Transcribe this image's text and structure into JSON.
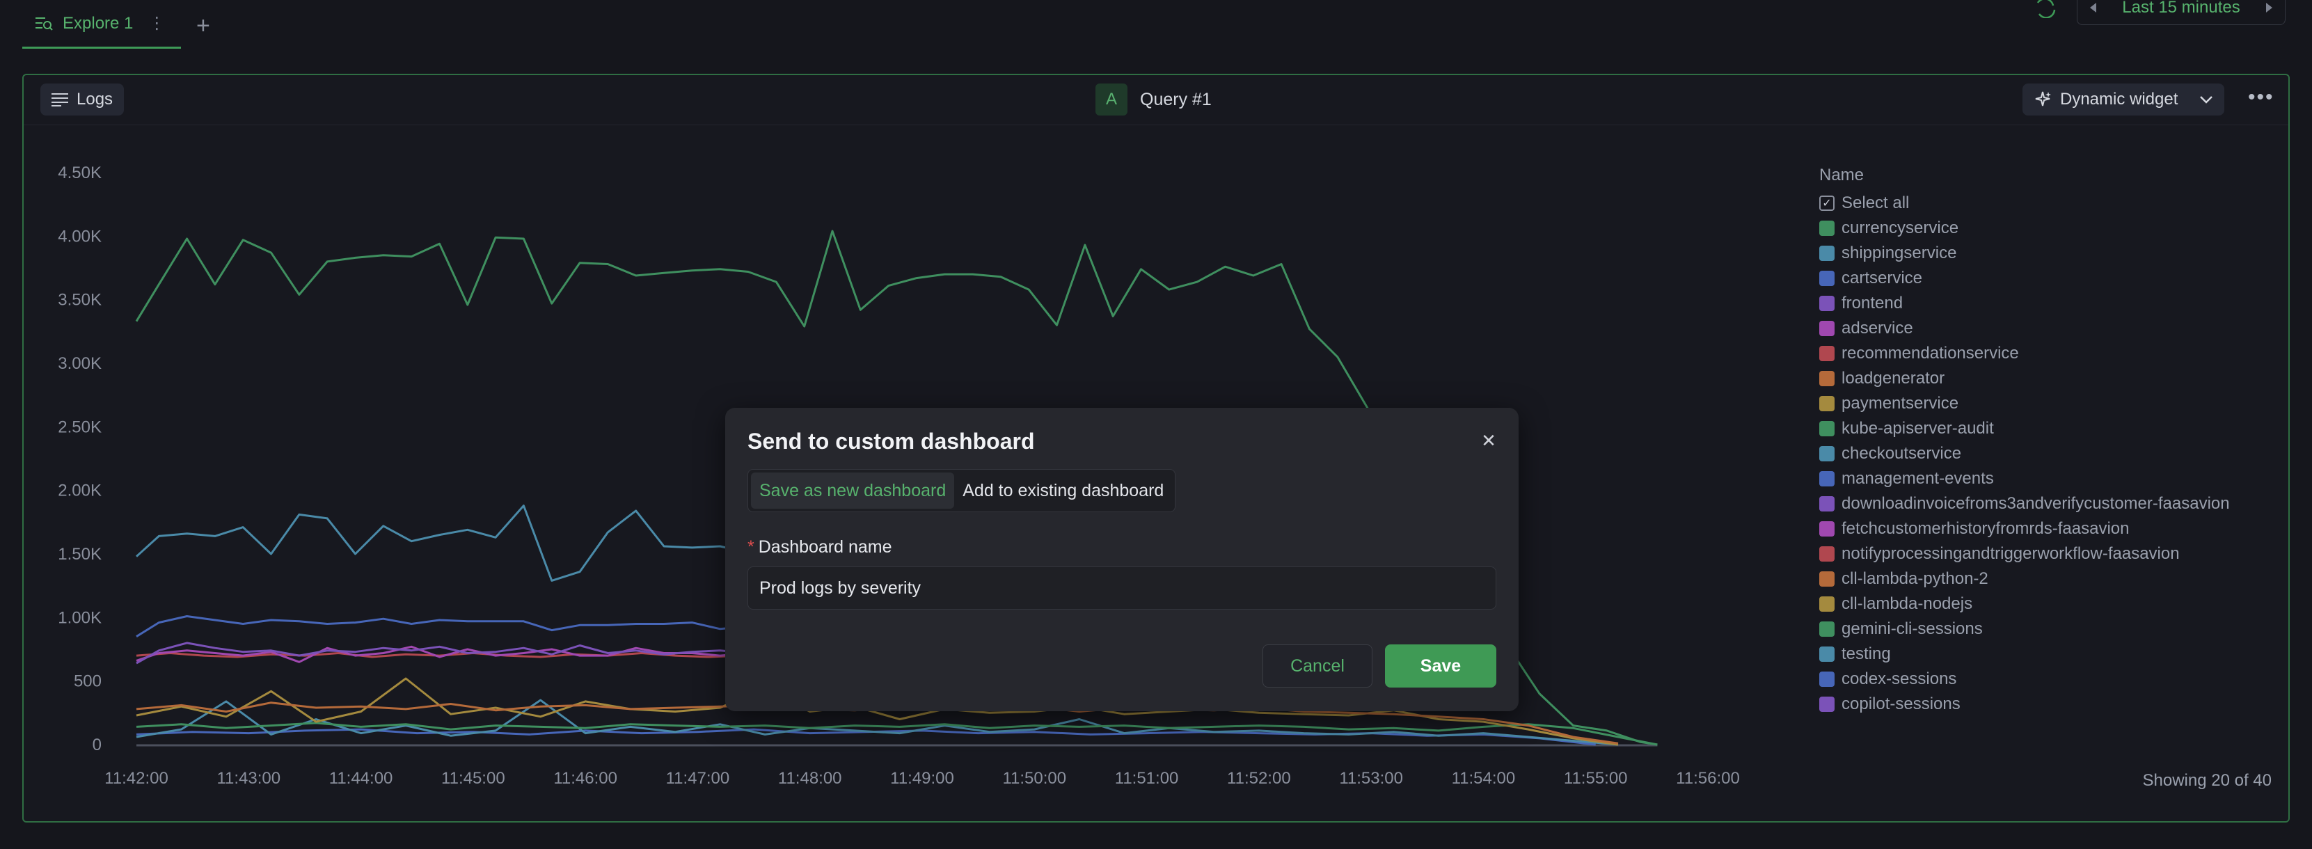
{
  "tabs": [
    {
      "label": "Explore 1"
    }
  ],
  "time_range": {
    "label": "Last 15 minutes"
  },
  "widget": {
    "source_label": "Logs",
    "query_badge": "A",
    "query_label": "Query #1",
    "visualization_label": "Dynamic widget"
  },
  "legend": {
    "title": "Name",
    "select_all": "Select all",
    "items": [
      {
        "label": "currencyservice",
        "color": "#3f8f5f"
      },
      {
        "label": "shippingservice",
        "color": "#4a8aa8"
      },
      {
        "label": "cartservice",
        "color": "#4766b8"
      },
      {
        "label": "frontend",
        "color": "#7b52b8"
      },
      {
        "label": "adservice",
        "color": "#a048b0"
      },
      {
        "label": "recommendationservice",
        "color": "#b0474f"
      },
      {
        "label": "loadgenerator",
        "color": "#b56a3a"
      },
      {
        "label": "paymentservice",
        "color": "#a48a3e"
      },
      {
        "label": "kube-apiserver-audit",
        "color": "#3f8f5f"
      },
      {
        "label": "checkoutservice",
        "color": "#4a8aa8"
      },
      {
        "label": "management-events",
        "color": "#4766b8"
      },
      {
        "label": "downloadinvoicefroms3andverifycustomer-faasavion",
        "color": "#7b52b8"
      },
      {
        "label": "fetchcustomerhistoryfromrds-faasavion",
        "color": "#a048b0"
      },
      {
        "label": "notifyprocessingandtriggerworkflow-faasavion",
        "color": "#b0474f"
      },
      {
        "label": "cll-lambda-python-2",
        "color": "#b56a3a"
      },
      {
        "label": "cll-lambda-nodejs",
        "color": "#a48a3e"
      },
      {
        "label": "gemini-cli-sessions",
        "color": "#3f8f5f"
      },
      {
        "label": "testing",
        "color": "#4a8aa8"
      },
      {
        "label": "codex-sessions",
        "color": "#4766b8"
      },
      {
        "label": "copilot-sessions",
        "color": "#7b52b8"
      }
    ],
    "showing_text": "Showing 20 of 40"
  },
  "chart_data": {
    "type": "line",
    "ylim": [
      0,
      4500
    ],
    "y_ticks": [
      "0",
      "500",
      "1.00K",
      "1.50K",
      "2.00K",
      "2.50K",
      "3.00K",
      "3.50K",
      "4.00K",
      "4.50K"
    ],
    "y_tick_values": [
      0,
      500,
      1000,
      1500,
      2000,
      2500,
      3000,
      3500,
      4000,
      4500
    ],
    "x_ticks": [
      "11:42:00",
      "11:43:00",
      "11:44:00",
      "11:45:00",
      "11:46:00",
      "11:47:00",
      "11:48:00",
      "11:49:00",
      "11:50:00",
      "11:51:00",
      "11:52:00",
      "11:53:00",
      "11:54:00",
      "11:55:00",
      "11:56:00"
    ],
    "x_minutes_range": [
      0,
      14
    ],
    "series": [
      {
        "name": "currencyservice",
        "color": "#3f8f5f",
        "x": [
          0,
          0.2,
          0.45,
          0.7,
          0.95,
          1.2,
          1.45,
          1.7,
          1.95,
          2.2,
          2.45,
          2.7,
          2.95,
          3.2,
          3.45,
          3.7,
          3.95,
          4.2,
          4.45,
          4.7,
          4.95,
          5.2,
          5.45,
          5.7,
          5.95,
          6.2,
          6.45,
          6.7,
          6.95,
          7.2,
          7.45,
          7.7,
          7.95,
          8.2,
          8.45,
          8.7,
          8.95,
          9.2,
          9.45,
          9.7,
          9.95,
          10.2,
          10.45,
          10.7,
          11.0,
          11.3,
          11.6,
          11.9,
          12.2,
          12.5,
          12.8,
          13.1,
          13.4,
          13.55
        ],
        "values": [
          3330,
          3620,
          3980,
          3620,
          3970,
          3870,
          3540,
          3800,
          3830,
          3850,
          3840,
          3940,
          3460,
          3990,
          3980,
          3470,
          3790,
          3780,
          3690,
          3710,
          3730,
          3740,
          3720,
          3640,
          3290,
          4040,
          3420,
          3610,
          3670,
          3700,
          3700,
          3680,
          3580,
          3300,
          3930,
          3370,
          3740,
          3580,
          3640,
          3760,
          3690,
          3780,
          3270,
          3050,
          2600,
          2200,
          1700,
          1200,
          800,
          400,
          150,
          110,
          20,
          0
        ]
      },
      {
        "name": "shippingservice",
        "color": "#4a8aa8",
        "x": [
          0,
          0.2,
          0.45,
          0.7,
          0.95,
          1.2,
          1.45,
          1.7,
          1.95,
          2.2,
          2.45,
          2.7,
          2.95,
          3.2,
          3.45,
          3.7,
          3.95,
          4.2,
          4.45,
          4.7,
          4.95,
          5.2,
          5.45,
          5.7,
          5.95
        ],
        "values": [
          1480,
          1640,
          1660,
          1640,
          1710,
          1500,
          1810,
          1780,
          1500,
          1720,
          1600,
          1650,
          1690,
          1630,
          1880,
          1290,
          1360,
          1670,
          1840,
          1560,
          1550,
          1560,
          1510,
          1470,
          1380
        ]
      },
      {
        "name": "cartservice",
        "color": "#4766b8",
        "x": [
          0,
          0.2,
          0.45,
          0.7,
          0.95,
          1.2,
          1.45,
          1.7,
          1.95,
          2.2,
          2.45,
          2.7,
          2.95,
          3.2,
          3.45,
          3.7,
          3.95,
          4.2,
          4.45,
          4.7,
          4.95,
          5.2,
          5.45,
          5.7,
          5.95
        ],
        "values": [
          850,
          960,
          1010,
          980,
          950,
          980,
          970,
          950,
          960,
          990,
          950,
          980,
          970,
          970,
          970,
          900,
          940,
          940,
          950,
          950,
          960,
          910,
          930,
          900,
          880
        ]
      },
      {
        "name": "frontend",
        "color": "#7b52b8",
        "x": [
          0,
          0.2,
          0.45,
          0.7,
          0.95,
          1.2,
          1.45,
          1.7,
          1.95,
          2.2,
          2.45,
          2.7,
          2.95,
          3.2,
          3.45,
          3.7,
          3.95,
          4.2,
          4.45,
          4.7,
          4.95,
          5.2,
          5.45,
          5.7,
          5.95
        ],
        "values": [
          640,
          740,
          800,
          760,
          730,
          740,
          700,
          740,
          730,
          760,
          740,
          770,
          720,
          730,
          760,
          710,
          780,
          720,
          740,
          710,
          730,
          740,
          720,
          730,
          740
        ]
      },
      {
        "name": "adservice",
        "color": "#a048b0",
        "x": [
          0,
          0.2,
          0.45,
          0.7,
          0.95,
          1.2,
          1.45,
          1.7,
          1.95,
          2.2,
          2.45,
          2.7,
          2.95,
          3.2,
          3.45,
          3.7,
          3.95,
          4.2,
          4.45,
          4.7,
          4.95,
          5.2,
          5.45,
          5.7,
          5.95
        ],
        "values": [
          660,
          720,
          740,
          720,
          700,
          730,
          650,
          760,
          700,
          720,
          770,
          690,
          750,
          700,
          720,
          750,
          700,
          700,
          760,
          720,
          720,
          700,
          720,
          720,
          700
        ]
      },
      {
        "name": "recommendationservice",
        "color": "#b0474f",
        "x": [
          0,
          0.3,
          0.6,
          0.9,
          1.2,
          1.5,
          1.8,
          2.1,
          2.4,
          2.7,
          3.0,
          3.3,
          3.6,
          3.9,
          4.2,
          4.5,
          4.8,
          5.1,
          5.4,
          5.7,
          6.0
        ],
        "values": [
          700,
          720,
          700,
          690,
          710,
          700,
          720,
          690,
          710,
          700,
          720,
          700,
          690,
          710,
          700,
          720,
          700,
          690,
          700,
          710,
          700
        ]
      },
      {
        "name": "loadgenerator",
        "color": "#b56a3a",
        "x": [
          0,
          0.4,
          0.8,
          1.2,
          1.6,
          2.0,
          2.4,
          2.8,
          3.2,
          3.6,
          4.0,
          4.4,
          4.8,
          5.2,
          5.6,
          6.0,
          6.4,
          6.8,
          7.2,
          7.6,
          8.0,
          8.4,
          8.8,
          9.2,
          9.6,
          10.0,
          10.4,
          10.8,
          11.2,
          11.6,
          12.0,
          12.4,
          12.8,
          13.2
        ],
        "values": [
          280,
          310,
          260,
          330,
          290,
          300,
          280,
          320,
          270,
          300,
          310,
          280,
          290,
          300,
          310,
          280,
          270,
          300,
          290,
          280,
          300,
          260,
          290,
          280,
          270,
          290,
          260,
          250,
          240,
          220,
          200,
          150,
          60,
          10
        ]
      },
      {
        "name": "paymentservice",
        "color": "#a48a3e",
        "x": [
          0,
          0.4,
          0.8,
          1.2,
          1.6,
          2.0,
          2.4,
          2.8,
          3.2,
          3.6,
          4.0,
          4.4,
          4.8,
          5.2,
          5.6,
          6.0,
          6.4,
          6.8,
          7.2,
          7.6,
          8.0,
          8.4,
          8.8,
          9.2,
          9.6,
          10.0,
          10.4,
          10.8,
          11.2,
          11.6,
          12.0,
          12.4,
          12.8,
          13.2
        ],
        "values": [
          230,
          300,
          220,
          420,
          180,
          260,
          520,
          240,
          290,
          220,
          340,
          280,
          260,
          290,
          450,
          260,
          300,
          200,
          280,
          250,
          260,
          300,
          240,
          260,
          280,
          250,
          240,
          230,
          270,
          200,
          180,
          120,
          50,
          0
        ]
      },
      {
        "name": "kube-apiserver-audit",
        "color": "#3f8f5f",
        "x": [
          0,
          0.4,
          0.8,
          1.2,
          1.6,
          2.0,
          2.4,
          2.8,
          3.2,
          3.6,
          4.0,
          4.4,
          4.8,
          5.2,
          5.6,
          6.0,
          6.4,
          6.8,
          7.2,
          7.6,
          8.0,
          8.4,
          8.8,
          9.2,
          9.6,
          10.0,
          10.4,
          10.8,
          11.2,
          11.6,
          12.0,
          12.4,
          12.8,
          13.2,
          13.55
        ],
        "values": [
          140,
          160,
          130,
          150,
          170,
          140,
          160,
          120,
          150,
          140,
          130,
          160,
          150,
          140,
          150,
          130,
          150,
          140,
          160,
          130,
          150,
          140,
          150,
          130,
          140,
          150,
          140,
          120,
          130,
          110,
          140,
          160,
          130,
          60,
          0
        ]
      },
      {
        "name": "checkoutservice",
        "color": "#4a8aa8",
        "x": [
          0,
          0.4,
          0.8,
          1.2,
          1.6,
          2.0,
          2.4,
          2.8,
          3.2,
          3.6,
          4.0,
          4.4,
          4.8,
          5.2,
          5.6,
          6.0,
          6.4,
          6.8,
          7.2,
          7.6,
          8.0,
          8.4,
          8.8,
          9.2,
          9.6,
          10.0,
          10.4,
          10.8,
          11.2,
          11.6,
          12.0,
          12.4,
          12.8,
          13.2
        ],
        "values": [
          60,
          120,
          340,
          80,
          200,
          90,
          150,
          70,
          110,
          350,
          90,
          140,
          100,
          160,
          80,
          130,
          110,
          90,
          150,
          100,
          120,
          200,
          90,
          130,
          100,
          110,
          90,
          80,
          100,
          70,
          90,
          60,
          30,
          0
        ]
      },
      {
        "name": "management-events",
        "color": "#4766b8",
        "x": [
          0,
          0.5,
          1.0,
          1.5,
          2.0,
          2.5,
          3.0,
          3.5,
          4.0,
          4.5,
          5.0,
          5.5,
          6.0,
          6.5,
          7.0,
          7.5,
          8.0,
          8.5,
          9.0,
          9.5,
          10.0,
          10.5,
          11.0,
          11.5,
          12.0,
          12.5,
          13.0
        ],
        "values": [
          80,
          100,
          90,
          110,
          120,
          90,
          100,
          80,
          110,
          90,
          100,
          120,
          90,
          100,
          110,
          90,
          100,
          80,
          90,
          100,
          90,
          80,
          90,
          70,
          80,
          50,
          0
        ]
      }
    ]
  },
  "modal": {
    "title": "Send to custom dashboard",
    "tabs": [
      {
        "label": "Save as new dashboard"
      },
      {
        "label": "Add to existing dashboard"
      }
    ],
    "active_tab_index": 0,
    "field_required_mark": "*",
    "field_label": "Dashboard name",
    "field_value": "Prod logs by severity",
    "cancel_label": "Cancel",
    "save_label": "Save"
  },
  "colors": {
    "accent": "#57b26d",
    "primary_button": "#3f9a55",
    "panel_border": "#2f6e43"
  }
}
